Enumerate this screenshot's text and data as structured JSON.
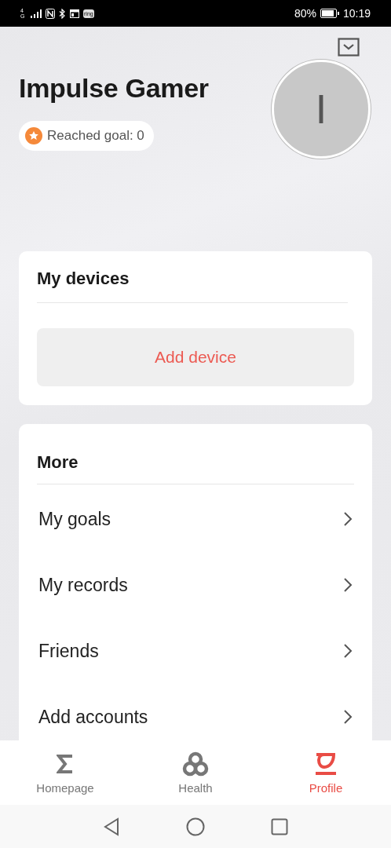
{
  "status_bar": {
    "network": "4G",
    "app_badge": "ring",
    "battery": "80%",
    "time": "10:19"
  },
  "profile": {
    "name": "Impulse Gamer",
    "reached_goal": "Reached goal: 0",
    "avatar_initial": "I"
  },
  "devices": {
    "title": "My devices",
    "add_button": "Add device"
  },
  "more": {
    "title": "More",
    "items": [
      {
        "label": "My goals"
      },
      {
        "label": "My records"
      },
      {
        "label": "Friends"
      },
      {
        "label": "Add accounts"
      }
    ]
  },
  "tabs": [
    {
      "label": "Homepage",
      "selected": false
    },
    {
      "label": "Health",
      "selected": false
    },
    {
      "label": "Profile",
      "selected": true
    }
  ]
}
